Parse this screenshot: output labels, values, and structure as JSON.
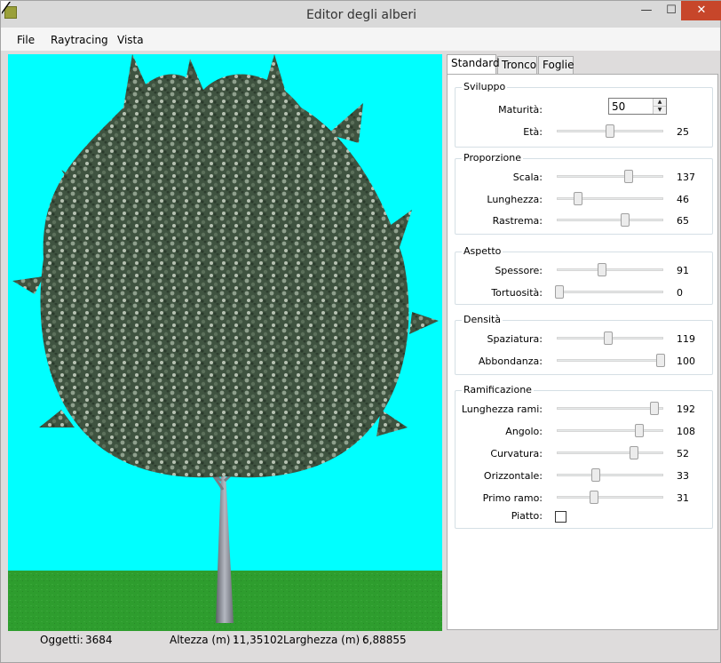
{
  "window": {
    "title": "Editor degli alberi",
    "controls": {
      "minimize": "—",
      "maximize": "☐",
      "close": "✕"
    }
  },
  "menu": [
    "File",
    "Raytracing",
    "Vista"
  ],
  "viewport": {
    "colors": {
      "sky": "#00ffff",
      "grass": "#2e9d2e",
      "trunk": "#9fa3ad",
      "leaves": "#4a5f4a"
    }
  },
  "status": {
    "objects_label": "Oggetti:",
    "objects_value": "3684",
    "height_label": "Altezza (m) :",
    "height_value": "11,35102",
    "width_label": "Larghezza (m) :",
    "width_value": "6,88855"
  },
  "tabs": [
    "Standard",
    "Tronco",
    "Foglie"
  ],
  "active_tab": "Standard",
  "groups": {
    "sviluppo": {
      "title": "Sviluppo",
      "maturita": {
        "label": "Maturità:",
        "value": "50"
      },
      "eta": {
        "label": "Età:",
        "value": "25",
        "level": 0.5
      }
    },
    "proporzione": {
      "title": "Proporzione",
      "scala": {
        "label": "Scala:",
        "value": "137",
        "level": 0.68
      },
      "lunghezza": {
        "label": "Lunghezza:",
        "value": "46",
        "level": 0.18
      },
      "rastrema": {
        "label": "Rastrema:",
        "value": "65",
        "level": 0.65
      }
    },
    "aspetto": {
      "title": "Aspetto",
      "spessore": {
        "label": "Spessore:",
        "value": "91",
        "level": 0.42
      },
      "tortuosita": {
        "label": "Tortuosità:",
        "value": "0",
        "level": 0.0
      }
    },
    "densita": {
      "title": "Densità",
      "spaziatura": {
        "label": "Spaziatura:",
        "value": "119",
        "level": 0.48
      },
      "abbondanza": {
        "label": "Abbondanza:",
        "value": "100",
        "level": 1.0
      }
    },
    "ramificazione": {
      "title": "Ramificazione",
      "lunghezza_rami": {
        "label": "Lunghezza rami:",
        "value": "192",
        "level": 0.94
      },
      "angolo": {
        "label": "Angolo:",
        "value": "108",
        "level": 0.79
      },
      "curvatura": {
        "label": "Curvatura:",
        "value": "52",
        "level": 0.74
      },
      "orizzontale": {
        "label": "Orizzontale:",
        "value": "33",
        "level": 0.36
      },
      "primo_ramo": {
        "label": "Primo ramo:",
        "value": "31",
        "level": 0.34
      },
      "piatto": {
        "label": "Piatto:",
        "checked": false
      }
    }
  }
}
